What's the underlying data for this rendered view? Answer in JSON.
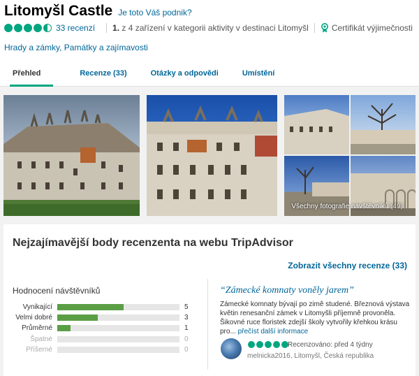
{
  "header": {
    "title": "Litomyšl Castle",
    "claim_link": "Je toto Váš podnik?",
    "bubbles": 4.5,
    "review_count": "33 recenzí",
    "rank_number": "1.",
    "rank_text": "z 4 zařízení v kategorii aktivity v destinaci Litomyšl",
    "certificate": "Certifikát výjimečnosti",
    "categories": "Hrady a zámky, Památky a zajímavosti",
    "accent_color": "#00a680",
    "link_color": "#006699"
  },
  "tabs": [
    {
      "label": "Přehled",
      "active": true
    },
    {
      "label": "Recenze (33)",
      "active": false
    },
    {
      "label": "Otázky a odpovědi",
      "active": false
    },
    {
      "label": "Umístění",
      "active": false
    }
  ],
  "gallery": {
    "all_photos_label": "Všechny fotografie návštěvníků",
    "all_photos_count": "(49)"
  },
  "reviews": {
    "section_title": "Nejzajímavější body recenzenta na webu TripAdvisor",
    "show_all": "Zobrazit všechny recenze (33)",
    "ratings_title": "Hodnocení návštěvníků",
    "ratings": [
      {
        "label": "Vynikající",
        "count": "5",
        "fraction": 0.545
      },
      {
        "label": "Velmi dobré",
        "count": "3",
        "fraction": 0.33
      },
      {
        "label": "Průměrné",
        "count": "1",
        "fraction": 0.11
      },
      {
        "label": "Špatné",
        "count": "0",
        "fraction": 0
      },
      {
        "label": "Příšerné",
        "count": "0",
        "fraction": 0
      }
    ],
    "bar_color": "#5b9e46",
    "featured": {
      "title": "“Zámecké komnaty voněly jarem”",
      "body": "Zámecké komnaty bývají po zimě studené. Březnová výstava květin renesanční zámek v Litomyšli příjemně provoněla. Šikovné ruce floristek zdejší školy vytvořily křehkou krásu pro... ",
      "more": "přečíst další informace",
      "bubbles": 5,
      "reviewed": "Recenzováno: před 4 týdny",
      "reviewer": "melnicka2016, Litomyšl, Česká republika"
    }
  }
}
